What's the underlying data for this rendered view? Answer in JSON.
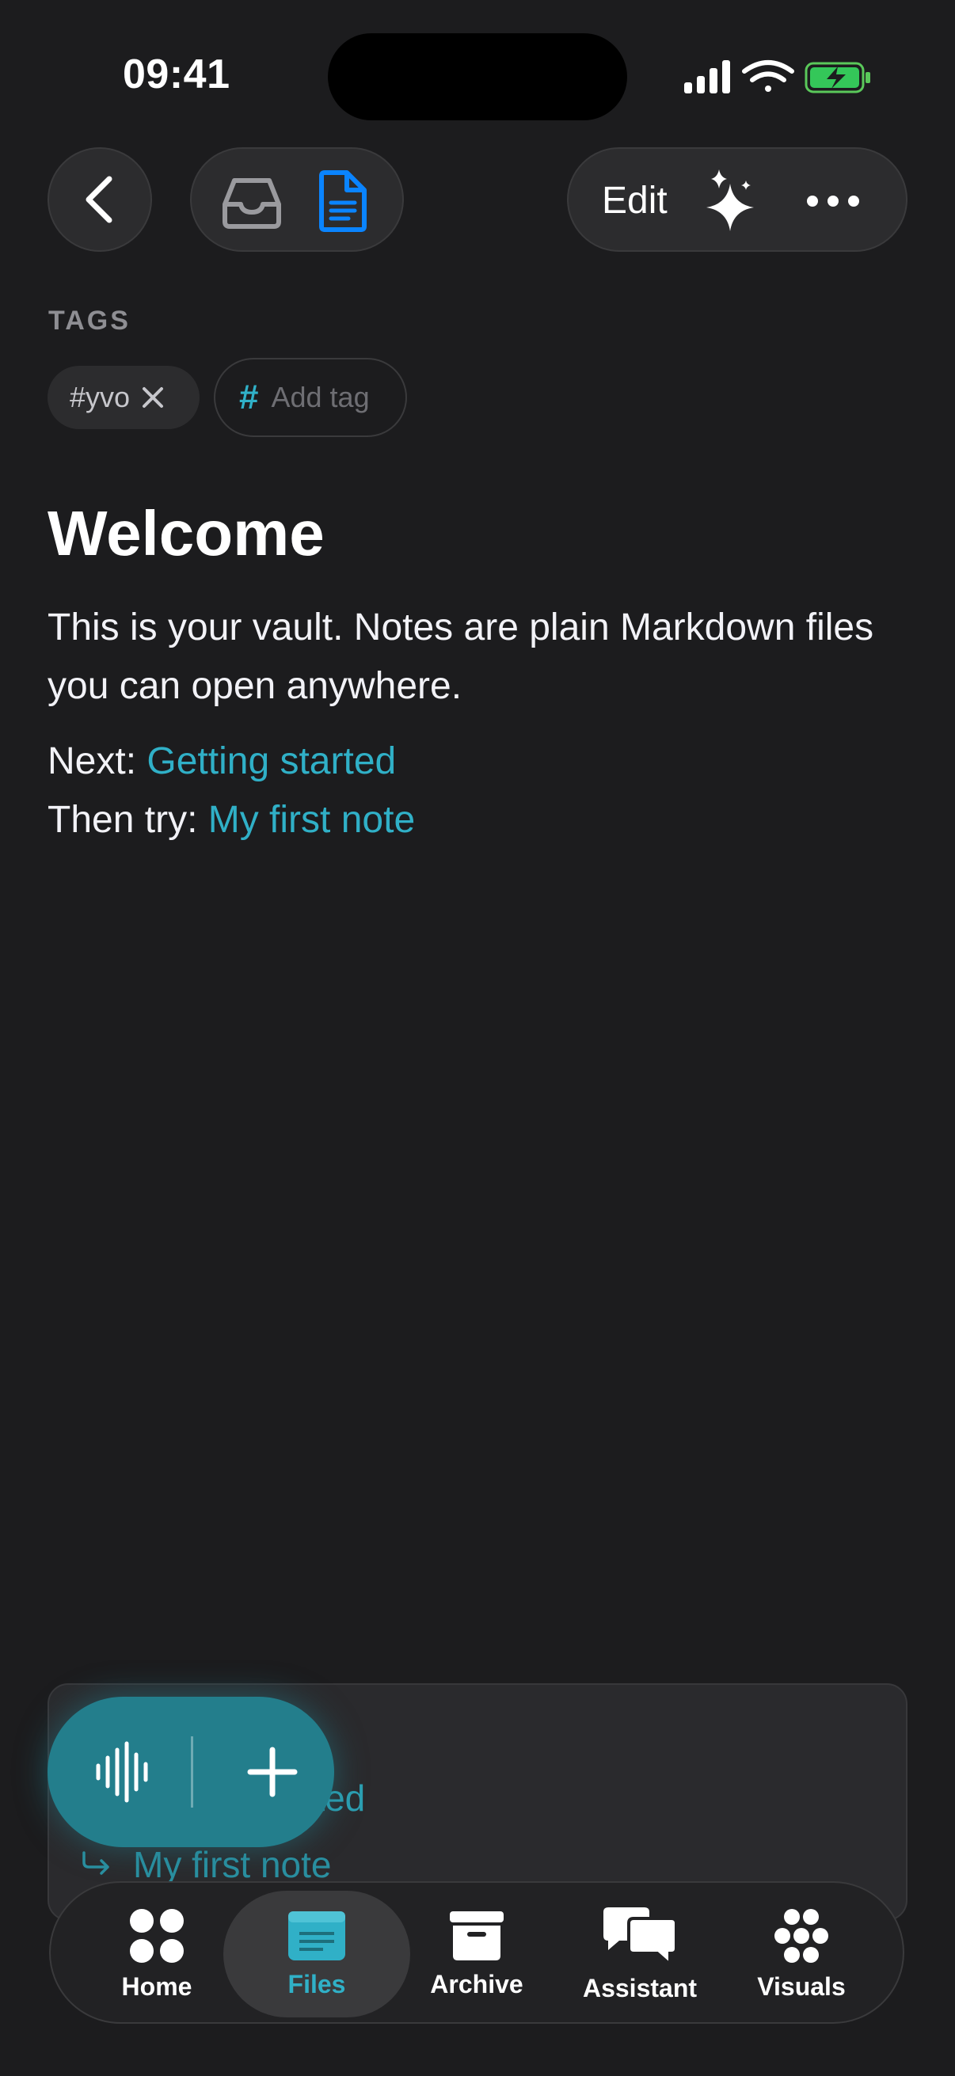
{
  "status_bar": {
    "time": "09:41"
  },
  "top_bar": {
    "edit_label": "Edit"
  },
  "tags": {
    "heading": "TAGS",
    "items": [
      {
        "label": "#yvo"
      }
    ],
    "add_placeholder": "Add tag",
    "hash_symbol": "#"
  },
  "note": {
    "title": "Welcome",
    "body": "This is your vault. Notes are plain Markdown files you can open anywhere.",
    "next_prefix": "Next: ",
    "next_link": "Getting started",
    "then_prefix": "Then try: ",
    "then_link": "My first note"
  },
  "preview": {
    "line1": "rted",
    "line2": "My first note"
  },
  "tabbar": {
    "items": [
      {
        "label": "Home",
        "icon": "home-icon"
      },
      {
        "label": "Files",
        "icon": "files-icon",
        "active": true
      },
      {
        "label": "Archive",
        "icon": "archive-icon"
      },
      {
        "label": "Assistant",
        "icon": "assistant-icon"
      },
      {
        "label": "Visuals",
        "icon": "visuals-icon"
      }
    ]
  },
  "colors": {
    "background": "#1c1c1e",
    "accent": "#30b0c7",
    "fab": "#237e8c",
    "doc_icon": "#0a84ff"
  }
}
